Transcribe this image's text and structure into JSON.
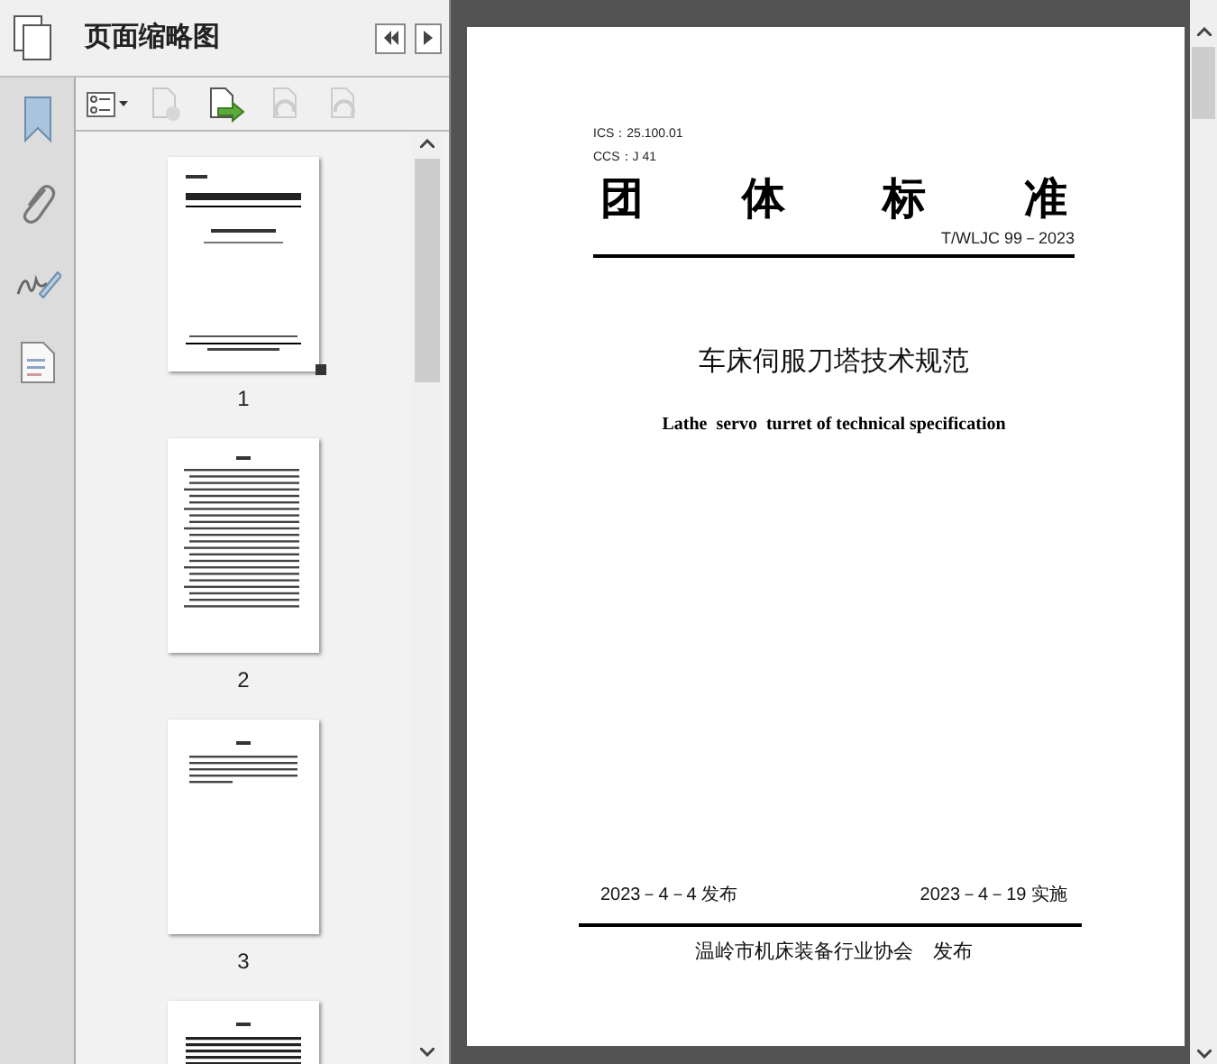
{
  "panel": {
    "title": "页面缩略图"
  },
  "thumbnails": [
    {
      "page": "1",
      "selected": true,
      "kind": "cover"
    },
    {
      "page": "2",
      "selected": false,
      "kind": "contents"
    },
    {
      "page": "3",
      "selected": false,
      "kind": "foreword"
    },
    {
      "selected": false,
      "kind": "text"
    }
  ],
  "document": {
    "ics": "ICS：25.100.01",
    "ccs": "CCS：J 41",
    "heading": [
      "团",
      "体",
      "标",
      "准"
    ],
    "code": "T/WLJC 99－2023",
    "title": "车床伺服刀塔技术规范",
    "title_en": "Lathe  servo  turret of technical specification",
    "publish_date": "2023－4－4 发布",
    "implement_date": "2023－4－19 实施",
    "publisher": "温岭市机床装备行业协会　发布"
  }
}
